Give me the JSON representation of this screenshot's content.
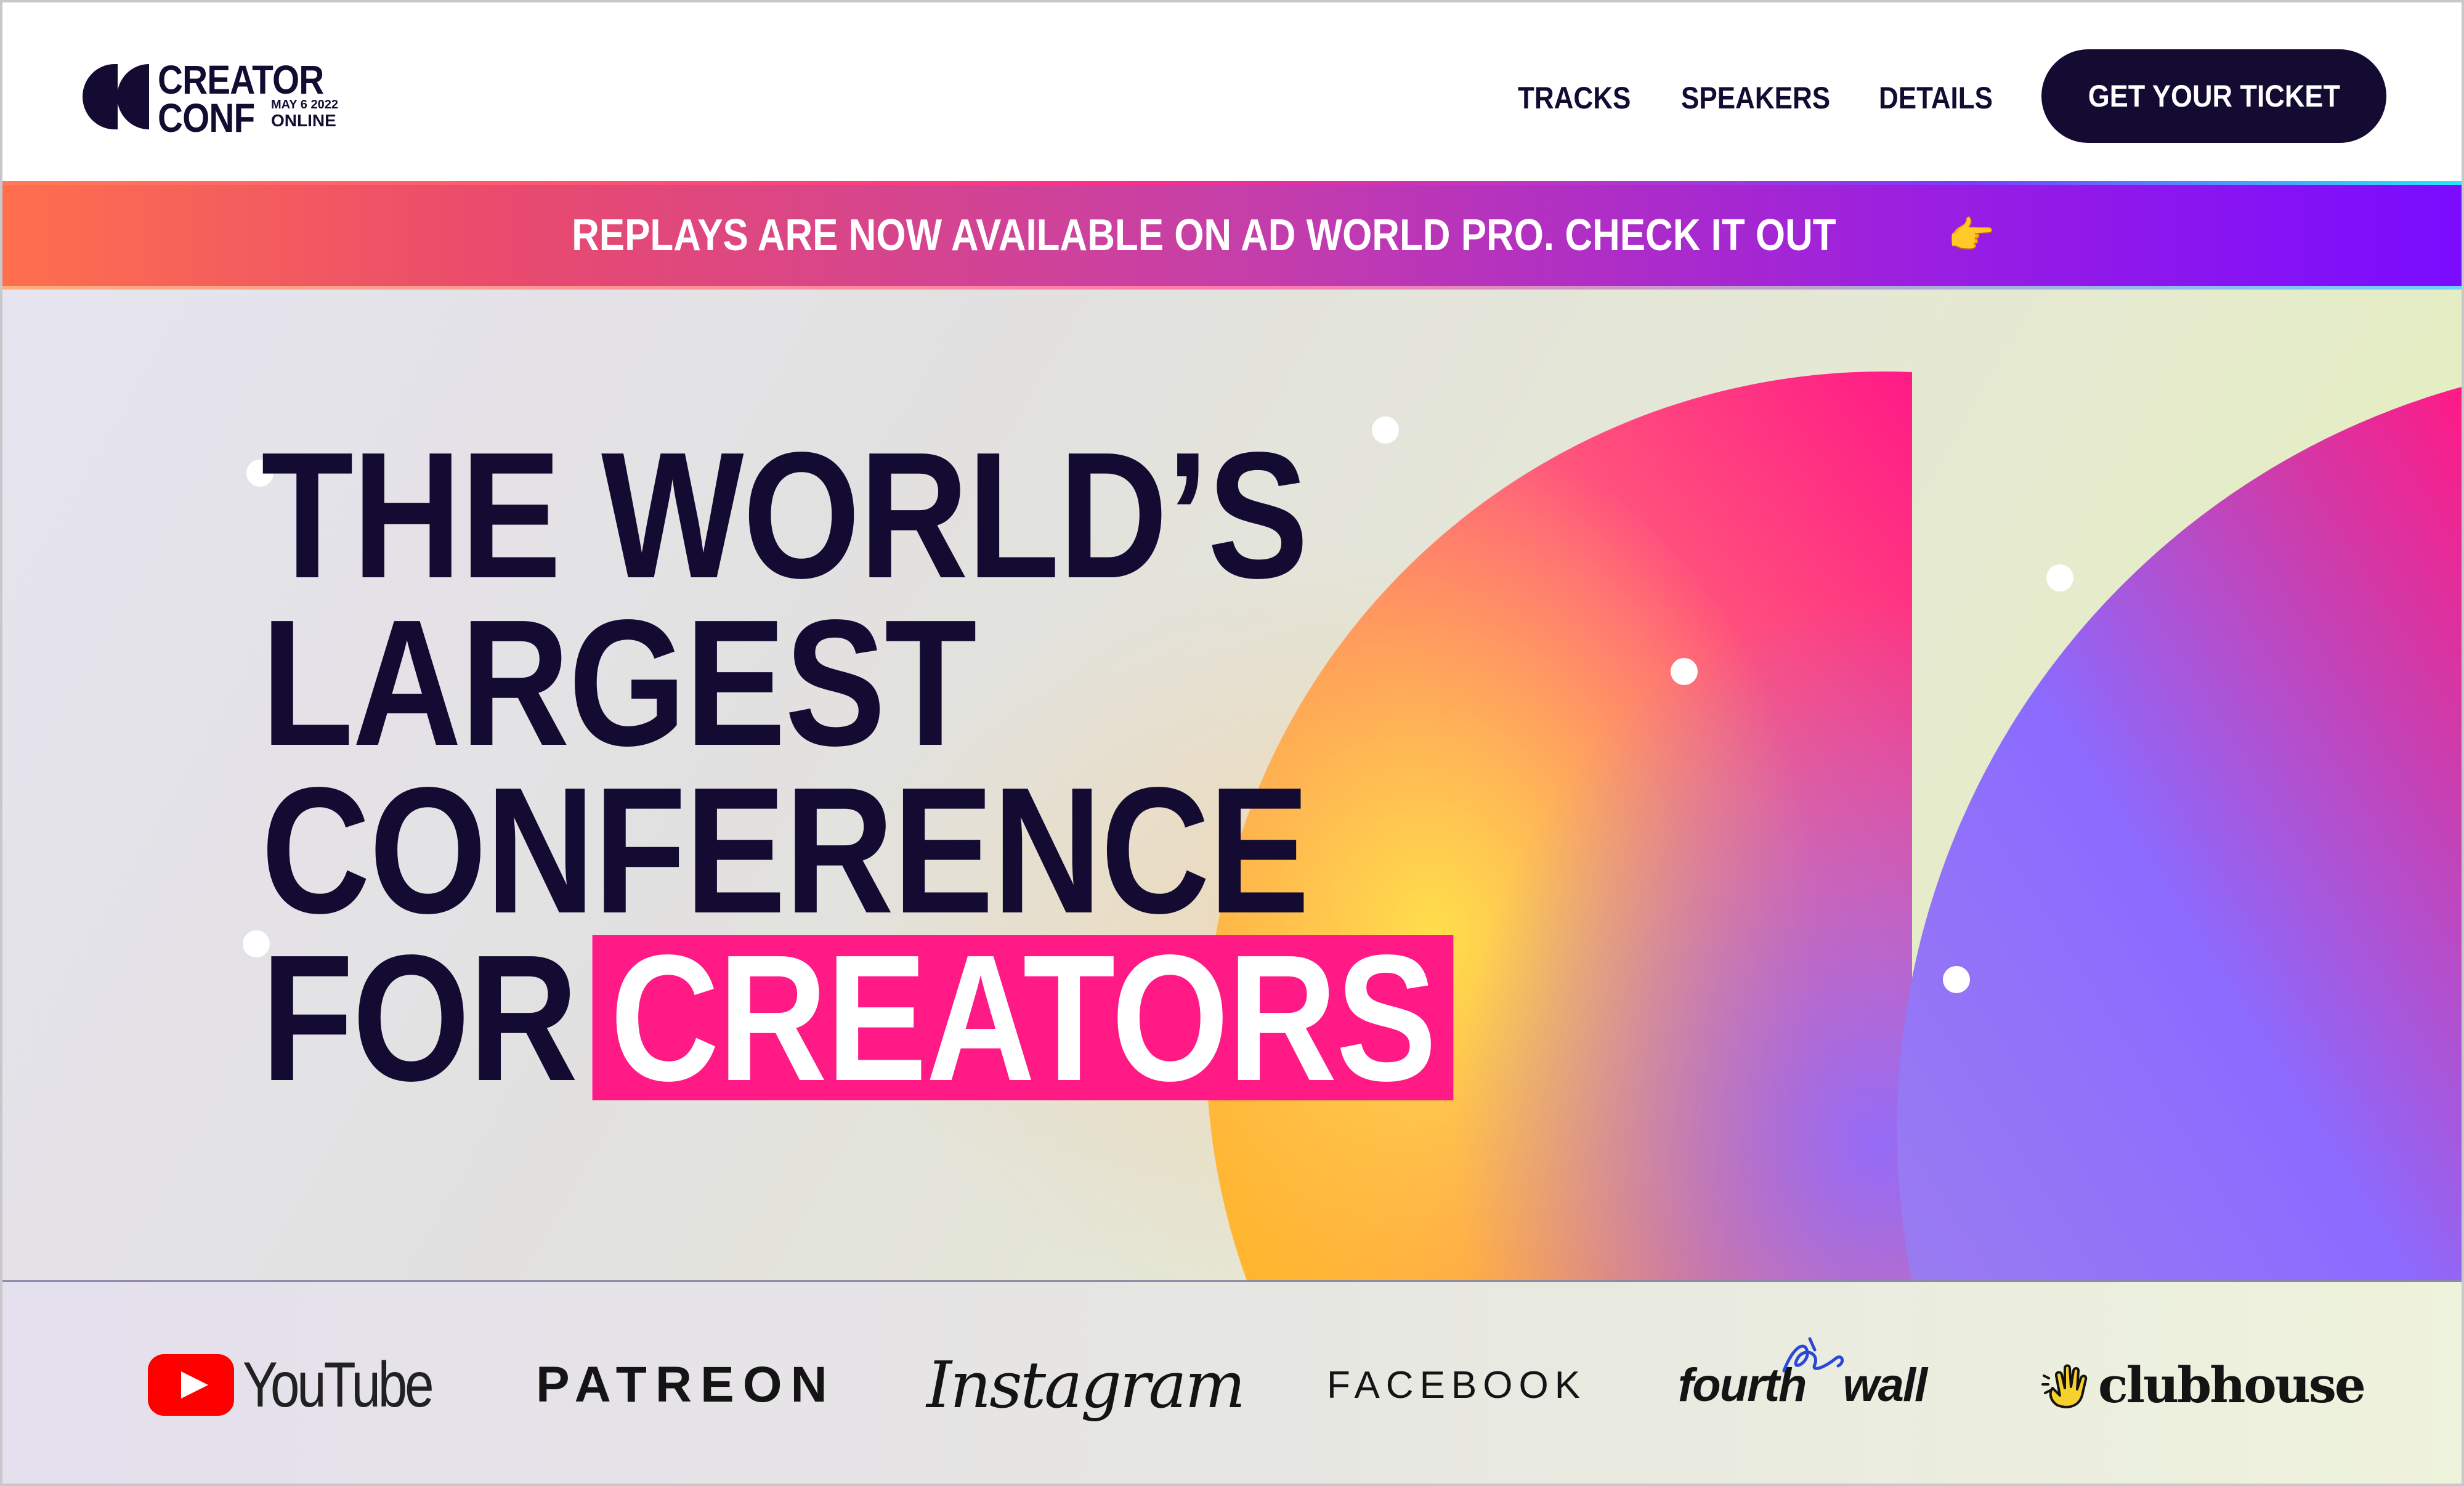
{
  "brand": {
    "name_line1": "CREATOR",
    "name_line2": "CONF",
    "date": "MAY 6 2022",
    "format": "ONLINE"
  },
  "nav": {
    "items": [
      {
        "label": "TRACKS"
      },
      {
        "label": "SPEAKERS"
      },
      {
        "label": "DETAILS"
      }
    ],
    "cta_label": "GET YOUR TICKET"
  },
  "banner": {
    "text": "REPLAYS ARE NOW AVAILABLE ON AD WORLD PRO. CHECK IT OUT",
    "emoji": "👉"
  },
  "hero": {
    "headline_lines": [
      "THE WORLD’S",
      "LARGEST",
      "CONFERENCE",
      "FOR"
    ],
    "highlight_word": "CREATORS"
  },
  "partners": [
    {
      "name": "YouTube",
      "icon": "youtube-play-icon"
    },
    {
      "name": "PATREON"
    },
    {
      "name": "Instagram"
    },
    {
      "name": "FACEBOOK"
    },
    {
      "name": "fourth wall",
      "part1": "fourth",
      "part2": "wall",
      "icon": "fourthwall-scribble-icon"
    },
    {
      "name": "clubhouse",
      "icon": "clubhouse-hand-icon"
    }
  ],
  "colors": {
    "ink": "#140b33",
    "highlight": "#ff1a86",
    "banner_start": "#ff6f4d",
    "banner_end": "#7a0cff",
    "cta_bg": "#140b33"
  }
}
